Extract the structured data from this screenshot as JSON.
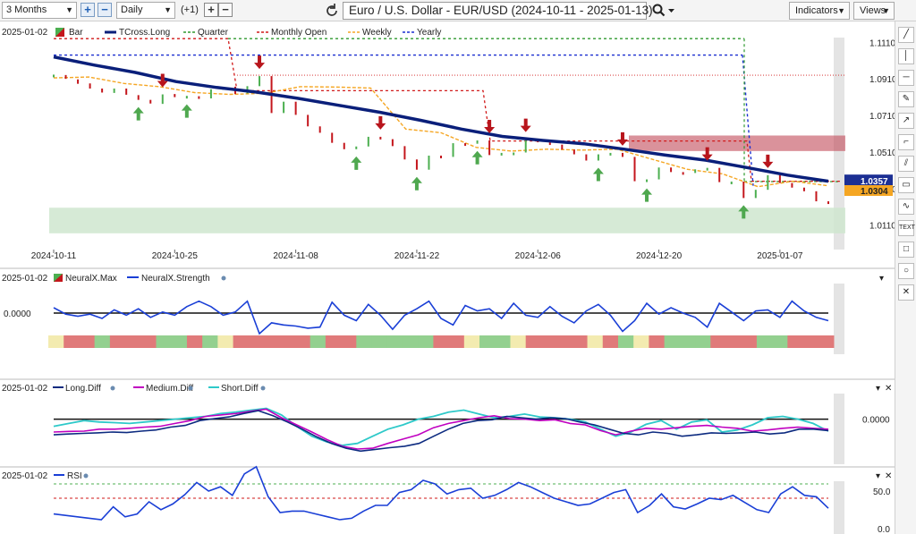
{
  "toolbar": {
    "range": "3 Months",
    "interval": "Daily",
    "offset": "(+1)",
    "title": "Euro / U.S. Dollar - EUR/USD (2024-10-11 - 2025-01-13)",
    "indicators": "Indicators",
    "views": "Views",
    "plus_label": "+",
    "minus_label": "−"
  },
  "tools": [
    "pen-line-icon",
    "vertical-line-icon",
    "horizontal-line-icon",
    "pen-icon",
    "ray-icon",
    "fib-icon",
    "channel-icon",
    "speech-bubble-icon",
    "wave-icon",
    "text-icon",
    "rectangle-icon",
    "circle-icon",
    "close-icon"
  ],
  "tool_labels": {
    "text": "TEXT"
  },
  "colors": {
    "tcross": "#0a1f7a",
    "quarter": "#2e9a2e",
    "monthly": "#d11a1a",
    "weekly": "#f5a623",
    "yearly": "#1b2fd0",
    "up": "#4caf50",
    "down": "#c4161c",
    "strength": "#1a3fd6",
    "longdiff": "#0d2b80",
    "mediumdiff": "#c000c0",
    "shortdiff": "#2ec9c9",
    "rsi": "#1a3fd6"
  },
  "chart_data": [
    {
      "type": "candlestick",
      "date_label": "2025-01-02",
      "legend": [
        "Bar",
        "TCross.Long",
        "Quarter",
        "Monthly Open",
        "Weekly",
        "Yearly"
      ],
      "x_tick_labels": [
        "2024-10-11",
        "2024-10-25",
        "2024-11-08",
        "2024-11-22",
        "2024-12-06",
        "2024-12-20",
        "2025-01-07"
      ],
      "y_tick_labels": [
        "1.1110",
        "1.0910",
        "1.0710",
        "1.0510",
        "1.0310",
        "1.0110"
      ],
      "ylim": [
        1.003,
        1.118
      ],
      "last_price": "1.0357",
      "level_price": "1.0304",
      "bars": [
        {
          "d": "2024-10-11",
          "o": 1.0932,
          "c": 1.0938
        },
        {
          "d": "2024-10-14",
          "o": 1.0936,
          "c": 1.0915
        },
        {
          "d": "2024-10-15",
          "o": 1.0912,
          "c": 1.0888
        },
        {
          "d": "2024-10-16",
          "o": 1.089,
          "c": 1.0862
        },
        {
          "d": "2024-10-17",
          "o": 1.0862,
          "c": 1.084
        },
        {
          "d": "2024-10-18",
          "o": 1.0838,
          "c": 1.0862
        },
        {
          "d": "2024-10-21",
          "o": 1.0862,
          "c": 1.0828
        },
        {
          "d": "2024-10-22",
          "o": 1.0826,
          "c": 1.08
        },
        {
          "d": "2024-10-23",
          "o": 1.08,
          "c": 1.078
        },
        {
          "d": "2024-10-24",
          "o": 1.0778,
          "c": 1.083
        },
        {
          "d": "2024-10-25",
          "o": 1.0832,
          "c": 1.0815
        },
        {
          "d": "2024-10-28",
          "o": 1.0815,
          "c": 1.0822
        },
        {
          "d": "2024-10-29",
          "o": 1.082,
          "c": 1.0808
        },
        {
          "d": "2024-10-30",
          "o": 1.0808,
          "c": 1.0858
        },
        {
          "d": "2024-10-31",
          "o": 1.0855,
          "c": 1.087
        },
        {
          "d": "2024-11-01",
          "o": 1.0872,
          "c": 1.0832
        },
        {
          "d": "2024-11-04",
          "o": 1.0835,
          "c": 1.0875
        },
        {
          "d": "2024-11-05",
          "o": 1.0875,
          "c": 1.093
        },
        {
          "d": "2024-11-06",
          "o": 1.093,
          "c": 1.0728
        },
        {
          "d": "2024-11-07",
          "o": 1.0728,
          "c": 1.079
        },
        {
          "d": "2024-11-08",
          "o": 1.079,
          "c": 1.0718
        },
        {
          "d": "2024-11-11",
          "o": 1.0718,
          "c": 1.0655
        },
        {
          "d": "2024-11-12",
          "o": 1.0655,
          "c": 1.062
        },
        {
          "d": "2024-11-13",
          "o": 1.062,
          "c": 1.0565
        },
        {
          "d": "2024-11-14",
          "o": 1.0565,
          "c": 1.053
        },
        {
          "d": "2024-11-15",
          "o": 1.053,
          "c": 1.0545
        },
        {
          "d": "2024-11-18",
          "o": 1.0545,
          "c": 1.0598
        },
        {
          "d": "2024-11-19",
          "o": 1.0598,
          "c": 1.0585
        },
        {
          "d": "2024-11-20",
          "o": 1.0585,
          "c": 1.0547
        },
        {
          "d": "2024-11-21",
          "o": 1.0547,
          "c": 1.0474
        },
        {
          "d": "2024-11-22",
          "o": 1.0474,
          "c": 1.0418
        },
        {
          "d": "2024-11-25",
          "o": 1.0418,
          "c": 1.0495
        },
        {
          "d": "2024-11-26",
          "o": 1.0495,
          "c": 1.0488
        },
        {
          "d": "2024-11-27",
          "o": 1.0488,
          "c": 1.0563
        },
        {
          "d": "2024-11-28",
          "o": 1.0563,
          "c": 1.056
        },
        {
          "d": "2024-11-29",
          "o": 1.056,
          "c": 1.0578
        },
        {
          "d": "2024-12-02",
          "o": 1.0578,
          "c": 1.0498
        },
        {
          "d": "2024-12-03",
          "o": 1.0498,
          "c": 1.051
        },
        {
          "d": "2024-12-04",
          "o": 1.051,
          "c": 1.0512
        },
        {
          "d": "2024-12-05",
          "o": 1.0512,
          "c": 1.0585
        },
        {
          "d": "2024-12-06",
          "o": 1.0585,
          "c": 1.0568
        },
        {
          "d": "2024-12-09",
          "o": 1.0568,
          "c": 1.0555
        },
        {
          "d": "2024-12-10",
          "o": 1.0555,
          "c": 1.0528
        },
        {
          "d": "2024-12-11",
          "o": 1.0528,
          "c": 1.0502
        },
        {
          "d": "2024-12-12",
          "o": 1.0502,
          "c": 1.0468
        },
        {
          "d": "2024-12-13",
          "o": 1.0468,
          "c": 1.0502
        },
        {
          "d": "2024-12-16",
          "o": 1.0502,
          "c": 1.051
        },
        {
          "d": "2024-12-17",
          "o": 1.051,
          "c": 1.0488
        },
        {
          "d": "2024-12-18",
          "o": 1.0488,
          "c": 1.0355
        },
        {
          "d": "2024-12-19",
          "o": 1.0355,
          "c": 1.0365
        },
        {
          "d": "2024-12-20",
          "o": 1.0365,
          "c": 1.043
        },
        {
          "d": "2024-12-23",
          "o": 1.043,
          "c": 1.0405
        },
        {
          "d": "2024-12-24",
          "o": 1.0405,
          "c": 1.04
        },
        {
          "d": "2024-12-26",
          "o": 1.04,
          "c": 1.042
        },
        {
          "d": "2024-12-27",
          "o": 1.042,
          "c": 1.0428
        },
        {
          "d": "2024-12-30",
          "o": 1.0428,
          "c": 1.035
        },
        {
          "d": "2024-12-31",
          "o": 1.035,
          "c": 1.0353
        },
        {
          "d": "2025-01-02",
          "o": 1.0353,
          "c": 1.0263
        },
        {
          "d": "2025-01-03",
          "o": 1.0263,
          "c": 1.0308
        },
        {
          "d": "2025-01-06",
          "o": 1.0308,
          "c": 1.0388
        },
        {
          "d": "2025-01-07",
          "o": 1.0388,
          "c": 1.0345
        },
        {
          "d": "2025-01-08",
          "o": 1.0345,
          "c": 1.032
        },
        {
          "d": "2025-01-09",
          "o": 1.032,
          "c": 1.03
        },
        {
          "d": "2025-01-10",
          "o": 1.03,
          "c": 1.0245
        },
        {
          "d": "2025-01-13",
          "o": 1.0245,
          "c": 1.0238
        }
      ],
      "tcross_long": [
        1.1035,
        1.099,
        1.095,
        1.09,
        1.0868,
        1.0842,
        1.0808,
        1.077,
        1.0732,
        1.0688,
        1.064,
        1.06,
        1.0578,
        1.056,
        1.053,
        1.0498,
        1.047,
        1.043,
        1.0388,
        1.0355
      ],
      "weekly": [
        1.092,
        1.0925,
        1.089,
        1.0872,
        1.084,
        1.083,
        1.0836,
        1.0872,
        1.087,
        1.0865,
        1.064,
        1.062,
        1.054,
        1.052,
        1.053,
        1.0525,
        1.053,
        1.0475,
        1.042,
        1.0395,
        1.0325,
        1.0355,
        1.033
      ],
      "quarter_level": 1.1135,
      "monthly_open_levels": [
        1.1135,
        1.0935,
        1.085,
        1.0575,
        1.0355
      ],
      "yearly_level": 1.1045,
      "red_zone": [
        1.052,
        1.0605
      ],
      "green_zone": [
        1.007,
        1.021
      ],
      "up_arrows": [
        "2024-10-22",
        "2024-10-28",
        "2024-11-15",
        "2024-11-22",
        "2024-11-29",
        "2024-12-13",
        "2024-12-19",
        "2025-01-02"
      ],
      "down_arrows": [
        "2024-10-24",
        "2024-11-05",
        "2024-11-19",
        "2024-12-02",
        "2024-12-05",
        "2024-12-17",
        "2024-12-27",
        "2025-01-06"
      ]
    },
    {
      "type": "line",
      "date_label": "2025-01-02",
      "legend": [
        "NeuralX.Max",
        "NeuralX.Strength"
      ],
      "y_tick_labels": [
        "0.0000"
      ],
      "ylim": [
        -1.2,
        1.2
      ],
      "strength": [
        0.25,
        -0.05,
        -0.15,
        -0.05,
        -0.25,
        0.15,
        -0.1,
        0.2,
        -0.2,
        0.05,
        -0.1,
        0.3,
        0.55,
        0.3,
        -0.1,
        0.05,
        0.55,
        -0.95,
        -0.45,
        -0.55,
        -0.6,
        -0.7,
        -0.65,
        0.5,
        -0.1,
        -0.35,
        0.4,
        -0.1,
        -0.75,
        -0.1,
        0.2,
        0.55,
        -0.25,
        -0.55,
        0.35,
        0.1,
        0.2,
        -0.25,
        0.45,
        -0.1,
        -0.2,
        0.3,
        -0.15,
        -0.45,
        0.1,
        0.4,
        -0.1,
        -0.85,
        -0.35,
        0.45,
        -0.05,
        0.25,
        0.0,
        -0.2,
        -0.65,
        0.45,
        0.05,
        -0.35,
        0.1,
        0.15,
        -0.2,
        0.55,
        0.1,
        -0.2,
        -0.35
      ],
      "max_states": [
        "Y",
        "R",
        "R",
        "G",
        "R",
        "R",
        "R",
        "G",
        "G",
        "R",
        "G",
        "Y",
        "R",
        "R",
        "R",
        "R",
        "R",
        "G",
        "R",
        "R",
        "G",
        "G",
        "G",
        "G",
        "G",
        "R",
        "R",
        "Y",
        "G",
        "G",
        "Y",
        "R",
        "R",
        "R",
        "R",
        "Y",
        "R",
        "G",
        "Y",
        "R",
        "G",
        "G",
        "G",
        "R",
        "R",
        "R",
        "G",
        "G",
        "R",
        "R",
        "R"
      ]
    },
    {
      "type": "line",
      "date_label": "2025-01-02",
      "legend": [
        "Long.Diff",
        "Medium.Diff",
        "Short.Diff"
      ],
      "y_tick_labels": [
        "0.0000"
      ],
      "ylim": [
        -1.3,
        0.9
      ],
      "long_diff": [
        -0.55,
        -0.52,
        -0.5,
        -0.48,
        -0.45,
        -0.47,
        -0.42,
        -0.38,
        -0.28,
        -0.22,
        -0.05,
        0.02,
        0.08,
        0.2,
        0.3,
        0.12,
        -0.1,
        -0.35,
        -0.62,
        -0.85,
        -1.02,
        -1.12,
        -1.06,
        -1.0,
        -0.95,
        -0.85,
        -0.6,
        -0.35,
        -0.15,
        -0.05,
        -0.02,
        0.1,
        0.05,
        0.0,
        0.05,
        0.02,
        -0.1,
        -0.2,
        -0.35,
        -0.5,
        -0.55,
        -0.45,
        -0.5,
        -0.6,
        -0.55,
        -0.48,
        -0.5,
        -0.48,
        -0.45,
        -0.52,
        -0.48,
        -0.35,
        -0.35,
        -0.4
      ],
      "medium_diff": [
        -0.45,
        -0.43,
        -0.42,
        -0.35,
        -0.35,
        -0.32,
        -0.28,
        -0.25,
        -0.15,
        -0.05,
        0.1,
        0.15,
        0.2,
        0.28,
        0.35,
        0.05,
        -0.2,
        -0.45,
        -0.72,
        -0.95,
        -1.05,
        -1.02,
        -0.85,
        -0.7,
        -0.55,
        -0.3,
        -0.15,
        -0.05,
        0.05,
        0.12,
        0.02,
        0.0,
        -0.05,
        -0.02,
        -0.15,
        -0.2,
        -0.4,
        -0.55,
        -0.42,
        -0.32,
        -0.35,
        -0.3,
        -0.25,
        -0.22,
        -0.28,
        -0.32,
        -0.42,
        -0.38,
        -0.32,
        -0.28,
        -0.32,
        -0.35
      ],
      "short_diff": [
        -0.25,
        -0.15,
        -0.05,
        -0.1,
        -0.12,
        -0.15,
        -0.1,
        -0.05,
        0.0,
        0.05,
        0.1,
        0.2,
        0.25,
        0.32,
        0.38,
        0.15,
        -0.25,
        -0.6,
        -0.8,
        -0.92,
        -0.85,
        -0.6,
        -0.35,
        -0.2,
        0.0,
        0.1,
        0.25,
        0.32,
        0.18,
        0.05,
        0.1,
        0.18,
        0.08,
        0.05,
        0.0,
        -0.1,
        -0.35,
        -0.6,
        -0.45,
        -0.18,
        -0.05,
        -0.35,
        -0.1,
        -0.02,
        -0.45,
        -0.38,
        -0.2,
        0.05,
        0.1,
        0.0,
        -0.15,
        -0.42
      ]
    },
    {
      "type": "line",
      "date_label": "2025-01-02",
      "legend": [
        "RSI"
      ],
      "y_tick_labels": [
        "50.0",
        "0.0"
      ],
      "ylim": [
        0,
        100
      ],
      "upper_level": 60,
      "lower_level": 40,
      "rsi": [
        18,
        16,
        14,
        12,
        10,
        28,
        14,
        18,
        35,
        24,
        32,
        45,
        62,
        50,
        56,
        44,
        74,
        84,
        42,
        20,
        22,
        22,
        18,
        14,
        10,
        12,
        22,
        30,
        30,
        48,
        52,
        65,
        60,
        46,
        52,
        54,
        40,
        44,
        52,
        62,
        56,
        48,
        40,
        35,
        30,
        32,
        40,
        48,
        52,
        20,
        30,
        46,
        28,
        25,
        32,
        40,
        38,
        44,
        34,
        24,
        20,
        46,
        56,
        44,
        42,
        26
      ]
    }
  ]
}
